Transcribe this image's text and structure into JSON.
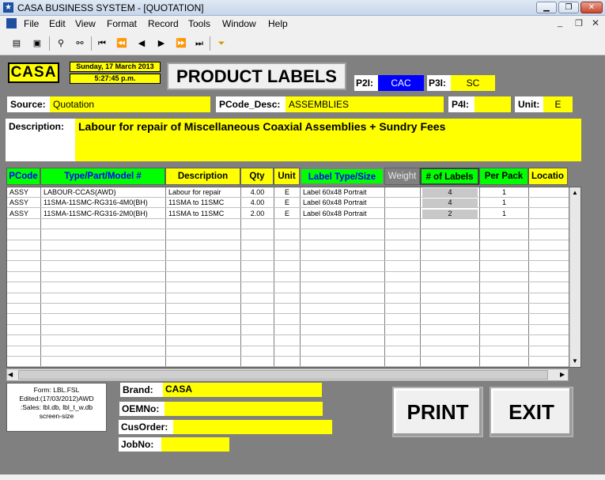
{
  "window": {
    "title": "CASA BUSINESS SYSTEM - [QUOTATION]"
  },
  "menu": [
    "File",
    "Edit",
    "View",
    "Format",
    "Record",
    "Tools",
    "Window",
    "Help"
  ],
  "logo": "CASA",
  "datetime": {
    "date": "Sunday, 17 March 2013",
    "time": "5:27:45 p.m."
  },
  "form_title": "PRODUCT LABELS",
  "p2i": {
    "label": "P2I:",
    "value": "CAC"
  },
  "p3i": {
    "label": "P3I:",
    "value": "SC"
  },
  "source": {
    "label": "Source:",
    "value": "Quotation"
  },
  "pcode_desc": {
    "label": "PCode_Desc:",
    "value": "ASSEMBLIES"
  },
  "p4i": {
    "label": "P4I:",
    "value": ""
  },
  "unit": {
    "label": "Unit:",
    "value": "E"
  },
  "description": {
    "label": "Description:",
    "value": "Labour for repair of Miscellaneous Coaxial Assemblies + Sundry Fees"
  },
  "columns": [
    "PCode",
    "Type/Part/Model #",
    "Description",
    "Qty",
    "Unit",
    "Label Type/Size",
    "Weight",
    "# of Labels",
    "Per Pack",
    "Locatio"
  ],
  "rows": [
    {
      "pcode": "ASSY",
      "part": "LABOUR-CCAS(AWD)",
      "desc": "Labour for repair",
      "qty": "4.00",
      "unit": "E",
      "label_type": "Label 60x48 Portrait",
      "weight": "",
      "labels": "4",
      "per_pack": "1",
      "location": ""
    },
    {
      "pcode": "ASSY",
      "part": "11SMA-11SMC-RG316-4M0(BH)",
      "desc": "11SMA to 11SMC",
      "qty": "4.00",
      "unit": "E",
      "label_type": "Label 60x48 Portrait",
      "weight": "",
      "labels": "4",
      "per_pack": "1",
      "location": ""
    },
    {
      "pcode": "ASSY",
      "part": "11SMA-11SMC-RG316-2M0(BH)",
      "desc": "11SMA to 11SMC",
      "qty": "2.00",
      "unit": "E",
      "label_type": "Label 60x48 Portrait",
      "weight": "",
      "labels": "2",
      "per_pack": "1",
      "location": ""
    }
  ],
  "form_info": [
    "Form: LBL.FSL",
    "Edited:(17/03/2012)AWD",
    ":Sales: lbl.db, lbl_t_w.db",
    "screen-size"
  ],
  "brand": {
    "label": "Brand:",
    "value": "CASA"
  },
  "oemno": {
    "label": "OEMNo:",
    "value": ""
  },
  "cusorder": {
    "label": "CusOrder:",
    "value": ""
  },
  "jobno": {
    "label": "JobNo:",
    "value": ""
  },
  "buttons": {
    "print": "PRINT",
    "exit": "EXIT"
  },
  "colors": {
    "field": "#ffff00",
    "header_green": "#00ff00",
    "header_yellow": "#ffff00",
    "p2i_blue": "#0000ff",
    "background": "#808080"
  }
}
